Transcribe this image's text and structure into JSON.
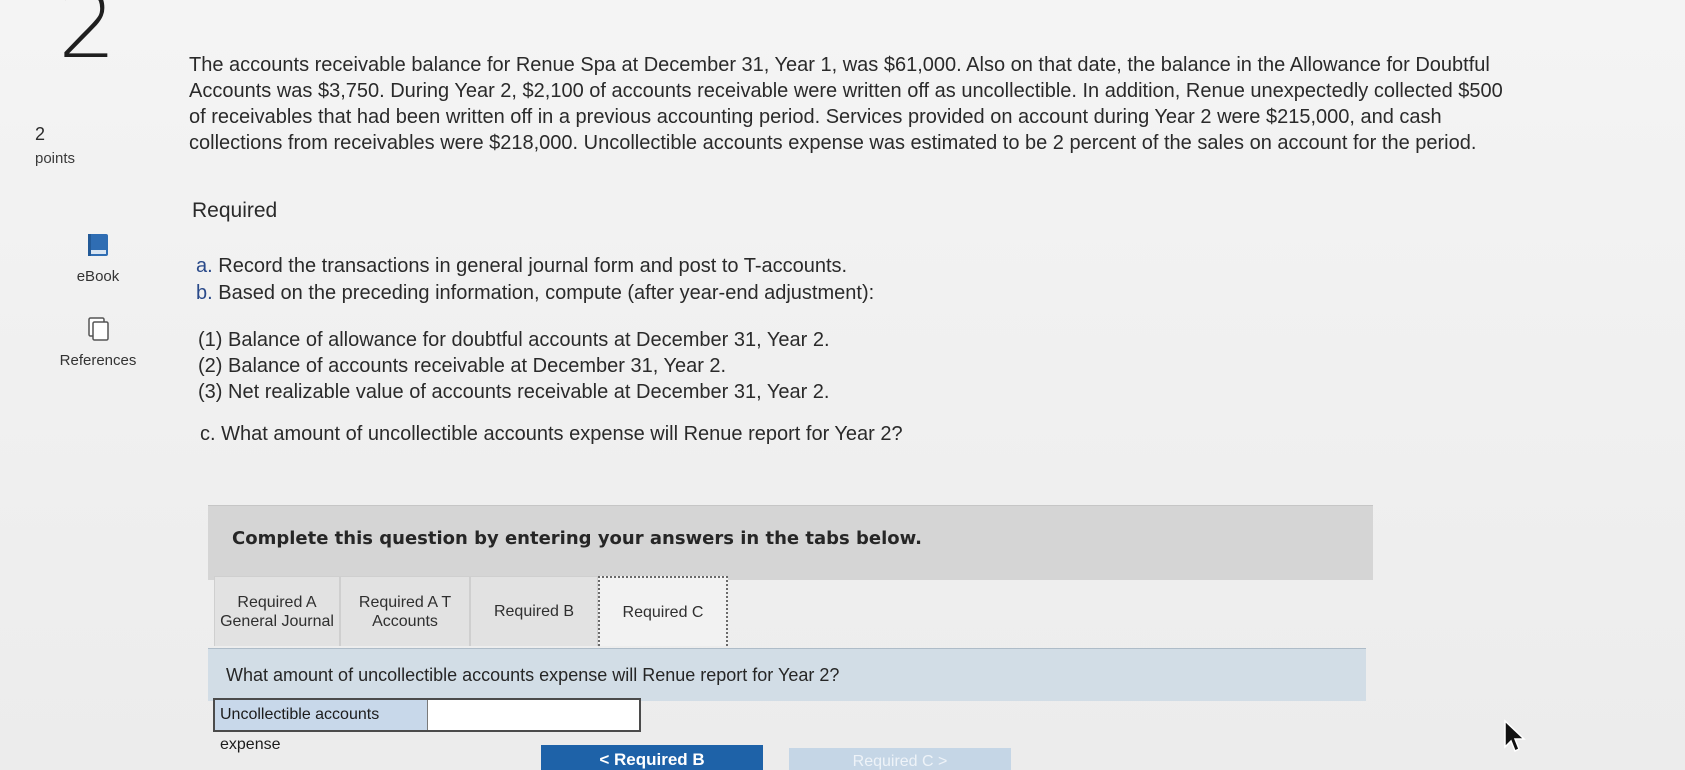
{
  "question_number": "2",
  "points": {
    "value": "2",
    "label": "points"
  },
  "tools": {
    "ebook_label": "eBook",
    "references_label": "References"
  },
  "question_text": "The accounts receivable balance for Renue Spa at December 31, Year 1, was $61,000. Also on that date, the balance in the Allowance for Doubtful Accounts was $3,750. During Year 2, $2,100 of accounts receivable were written off as uncollectible. In addition, Renue unexpectedly collected $500 of receivables that had been written off in a previous accounting period. Services provided on account during Year 2 were $215,000, and cash collections from receivables were $218,000. Uncollectible accounts expense was estimated to be 2 percent of the sales on account for the period.",
  "required_heading": "Required",
  "requirements": [
    {
      "tag": "a.",
      "text": "Record the transactions in general journal form and post to T-accounts."
    },
    {
      "tag": "b.",
      "text": "Based on the preceding information, compute (after year-end adjustment):"
    }
  ],
  "sub_requirements": [
    {
      "tag": "(1)",
      "text": "Balance of allowance for doubtful accounts at December 31, Year 2."
    },
    {
      "tag": "(2)",
      "text": "Balance of accounts receivable at December 31, Year 2."
    },
    {
      "tag": "(3)",
      "text": "Net realizable value of accounts receivable at December 31, Year 2."
    }
  ],
  "requirement_c": {
    "tag": "c.",
    "text": "What amount of uncollectible accounts expense will Renue report for Year 2?"
  },
  "instructions": "Complete this question by entering your answers in the tabs below.",
  "tabs": [
    {
      "label": "Required A General Journal"
    },
    {
      "label": "Required A T Accounts"
    },
    {
      "label": "Required B"
    },
    {
      "label": "Required C",
      "active": true
    }
  ],
  "tab_question": "What amount of uncollectible accounts expense will Renue report for Year 2?",
  "answer": {
    "label": "Uncollectible accounts expense",
    "value": ""
  },
  "navigation": {
    "prev_label": "<  Required B",
    "next_label": "Required C  >"
  },
  "colors": {
    "accent": "#1e62a8",
    "panel": "#d5d5d5",
    "answer_panel": "#d2dde6"
  }
}
